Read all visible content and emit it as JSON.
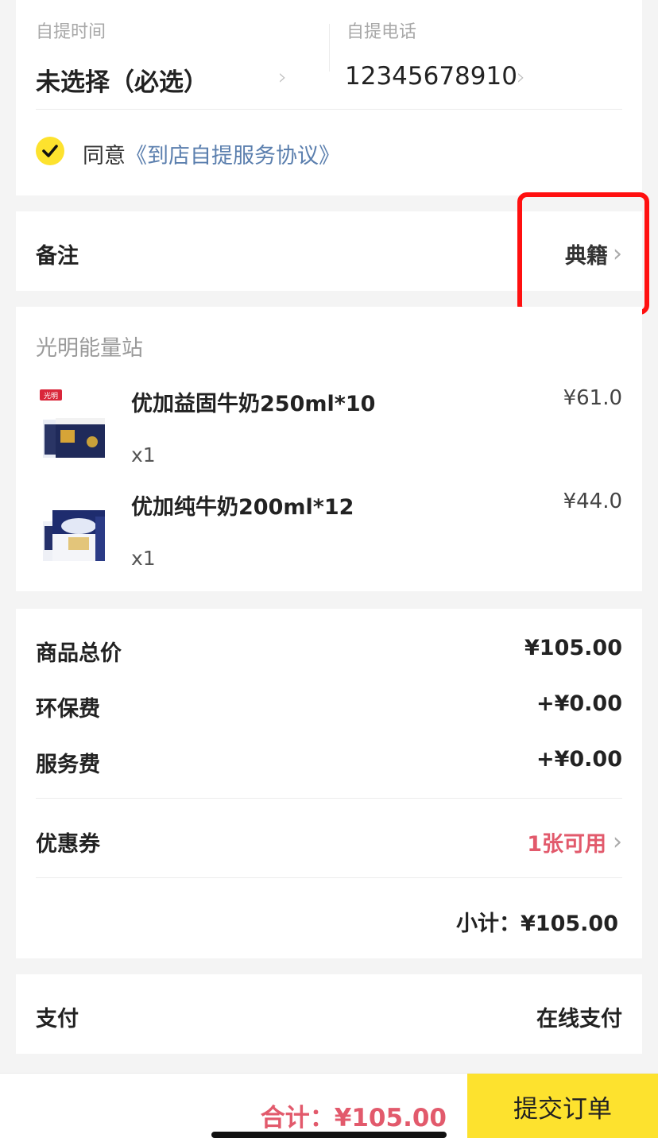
{
  "pickup": {
    "time_label": "自提时间",
    "time_value": "未选择（必选）",
    "phone_label": "自提电话",
    "phone_value": "12345678910",
    "agree_text": "同意",
    "agree_link": "《到店自提服务协议》"
  },
  "remark": {
    "label": "备注",
    "value": "典籍"
  },
  "store": {
    "name": "光明能量站",
    "products": [
      {
        "name": "优加益固牛奶250ml*10",
        "price": "¥61.0",
        "qty": "x1",
        "brand": "光明"
      },
      {
        "name": "优加纯牛奶200ml*12",
        "price": "¥44.0",
        "qty": "x1"
      }
    ]
  },
  "summary": {
    "goods_total_label": "商品总价",
    "goods_total_value": "¥105.00",
    "eco_fee_label": "环保费",
    "eco_fee_value": "+¥0.00",
    "service_fee_label": "服务费",
    "service_fee_value": "+¥0.00",
    "coupon_label": "优惠券",
    "coupon_value": "1张可用",
    "subtotal": "小计：¥105.00"
  },
  "payment": {
    "label": "支付",
    "value": "在线支付"
  },
  "bottom": {
    "total": "合计：¥105.00",
    "submit": "提交订单"
  },
  "colors": {
    "accent_yellow": "#fde22e",
    "price_red": "#e25a6c",
    "link_blue": "#5b7fae",
    "highlight_red": "#ff1010"
  }
}
